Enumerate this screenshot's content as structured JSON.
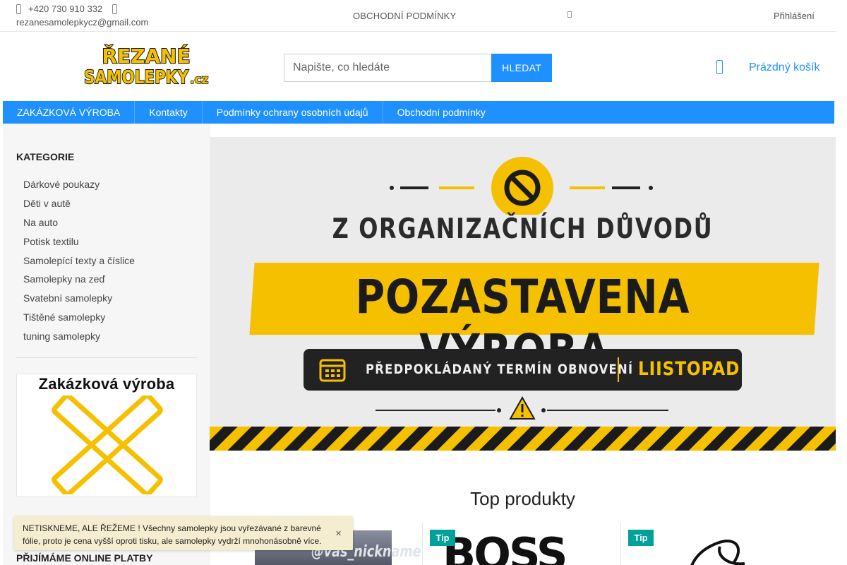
{
  "topbar": {
    "phone": "+420 730 910 332",
    "email": "rezanesamolepkycz@gmail.com",
    "terms_link": "OBCHODNÍ PODMÍNKY",
    "more_icon": "more-icon",
    "login": "Přihlášení"
  },
  "header": {
    "logo_line1": "ŘEZANÉ",
    "logo_line2": "SAMOLEPKY",
    "logo_tld": ".cz",
    "search_placeholder": "Napište, co hledáte",
    "search_button": "HLEDAT",
    "cart_icon": "cart-icon",
    "cart_label": "Prázdný košík"
  },
  "nav": {
    "items": [
      {
        "label": "ZAKÁZKOVÁ VÝROBA"
      },
      {
        "label": "Kontakty"
      },
      {
        "label": "Podmínky ochrany osobních údajů"
      },
      {
        "label": "Obchodní podmínky"
      }
    ]
  },
  "sidebar": {
    "title": "KATEGORIE",
    "categories": [
      {
        "label": "Dárkové poukazy"
      },
      {
        "label": "Děti v autě"
      },
      {
        "label": "Na auto"
      },
      {
        "label": "Potisk textilu"
      },
      {
        "label": "Samolepící texty a číslice"
      },
      {
        "label": "Samolepky na zeď"
      },
      {
        "label": "Svatební samolepky"
      },
      {
        "label": "Tištěné samolepky"
      },
      {
        "label": "tuning samolepky"
      }
    ],
    "custom_banner_title": "Zakázková výroba",
    "payments_title": "PŘIJÍMÁME ONLINE PLATBY"
  },
  "hero": {
    "notice": "Z ORGANIZAČNÍCH DŮVODŮ",
    "headline": "POZASTAVENA VÝROBA.",
    "renewal_label": "PŘEDPOKLÁDANÝ TERMÍN OBNOVENÍ",
    "renewal_month": "LIISTOPAD",
    "colors": {
      "yellow": "#f5c000",
      "dark": "#1b1b1b"
    }
  },
  "top_products": {
    "title": "Top produkty",
    "items": [
      {
        "image_text": "@vas_nickname",
        "badge": ""
      },
      {
        "image_text": "BOSS",
        "badge": "Tip"
      },
      {
        "image_text": "",
        "badge": "Tip"
      }
    ]
  },
  "notice_bar": {
    "text": "NETISKNEME, ALE ŘEŽEME ! Všechny samolepky jsou vyřezávané z barevné fólie, proto je cena vyšší oproti tisku, ale samolepky vydrží mnohonásobně více.",
    "close_icon": "close-icon"
  },
  "colors": {
    "accent": "#1e90ff",
    "badge": "#00a19a",
    "notice_bg": "#f5edd0"
  }
}
